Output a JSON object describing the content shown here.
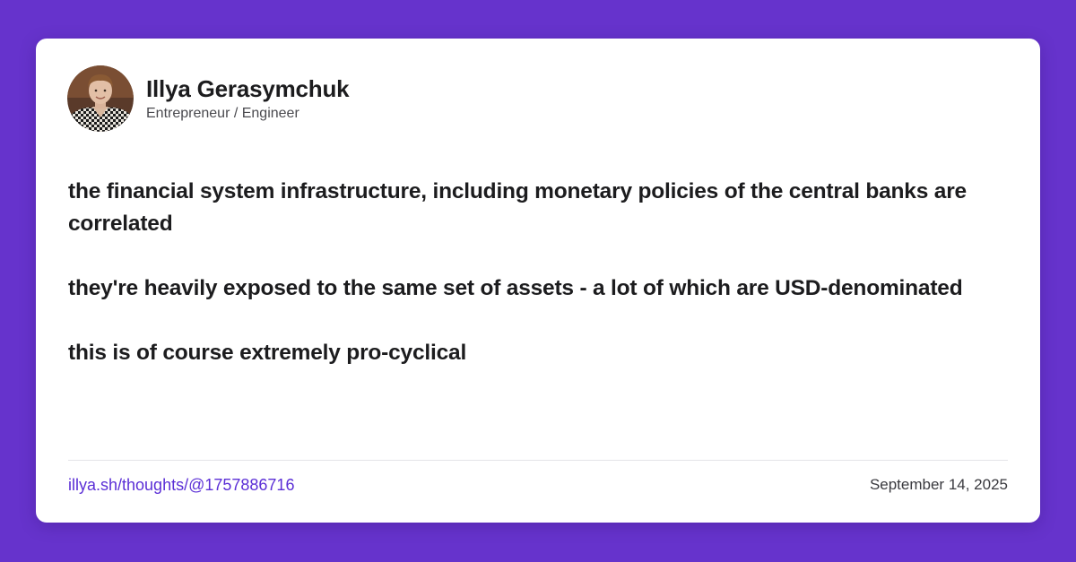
{
  "author": {
    "name": "Illya Gerasymchuk",
    "role": "Entrepreneur / Engineer",
    "avatar_icon": "profile-photo"
  },
  "post": {
    "paragraphs": [
      "the financial system infrastructure, including monetary policies of the central banks are correlated",
      "they're heavily exposed to the same set of assets - a lot of which are USD-denominated",
      "this is of course extremely pro-cyclical"
    ]
  },
  "footer": {
    "link": "illya.sh/thoughts/@1757886716",
    "date": "September 14, 2025"
  },
  "colors": {
    "background": "#6633cc",
    "card": "#ffffff",
    "link": "#5b2fd6",
    "text": "#1c1c1e"
  }
}
